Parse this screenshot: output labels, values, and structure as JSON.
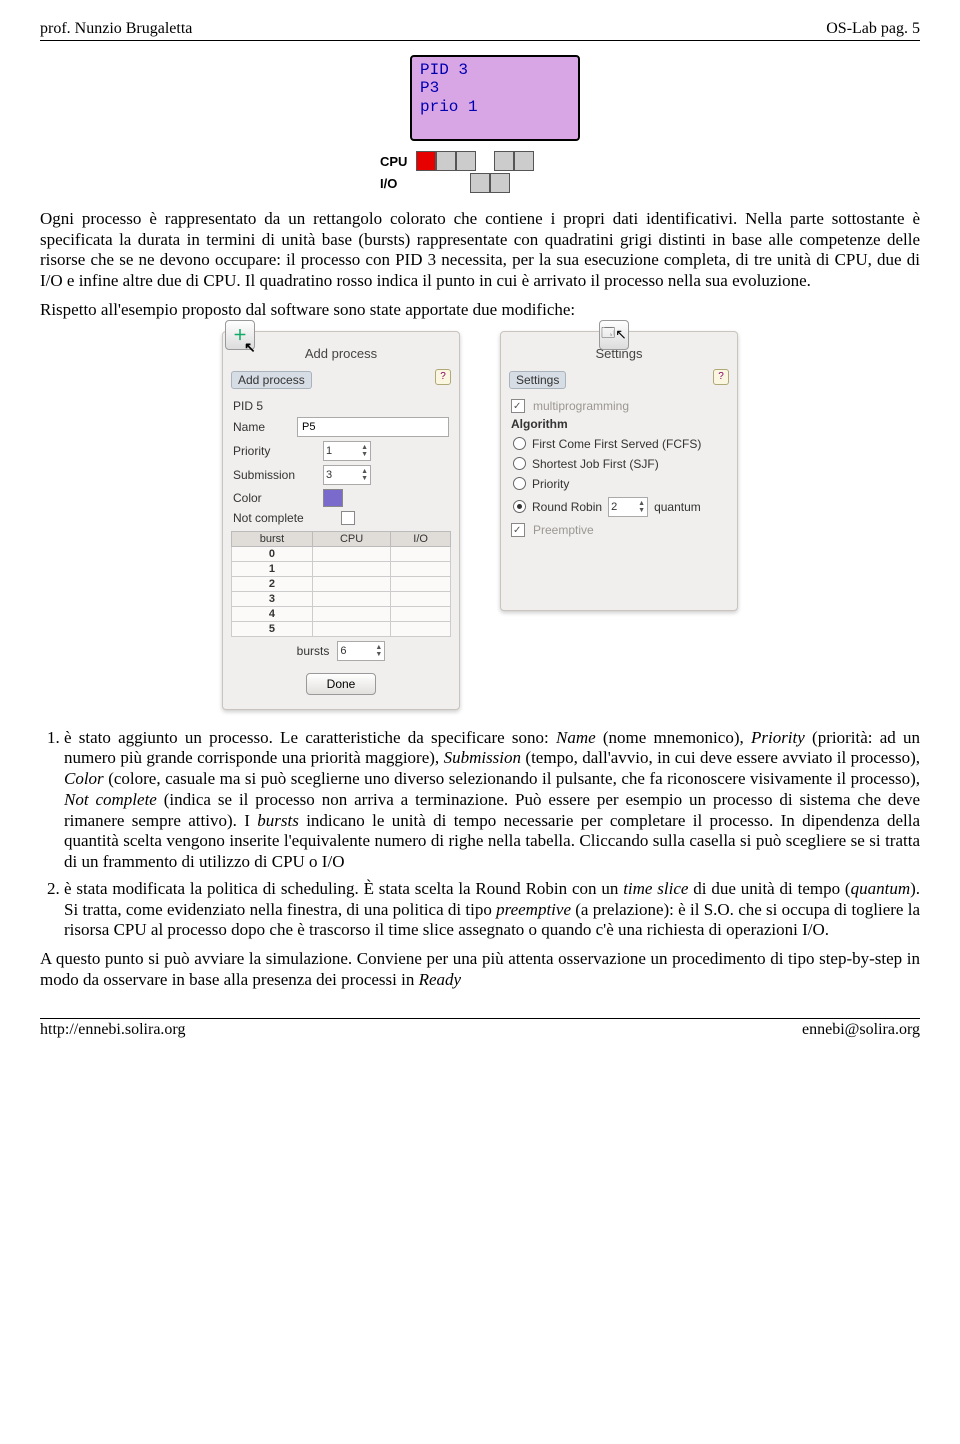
{
  "header": {
    "left": "prof. Nunzio Brugaletta",
    "right": "OS-Lab pag. 5"
  },
  "footer": {
    "left": "http://ennebi.solira.org",
    "right": "ennebi@solira.org"
  },
  "diagram": {
    "pid": "PID 3",
    "pname": "P3",
    "prio": "prio 1",
    "cpu_label": "CPU",
    "io_label": "I/O",
    "cpu_cells": [
      "red",
      "grey",
      "grey",
      "gap",
      "grey",
      "grey"
    ],
    "io_cells": [
      "gap",
      "gap",
      "gap",
      "grey",
      "grey"
    ]
  },
  "para1": "Ogni processo è rappresentato da un rettangolo colorato che contiene i propri dati identificativi. Nella parte sottostante è specificata la durata in termini di unità base (bursts) rappresentate con quadratini grigi distinti in base alle competenze delle risorse che se ne devono occupare: il processo con PID 3 necessita, per la sua esecuzione completa, di tre unità di CPU, due di I/O e infine altre due di CPU. Il quadratino rosso indica il punto in cui è arrivato il processo nella sua evoluzione.",
  "para2": "Rispetto all'esempio proposto dal software sono state apportate due modifiche:",
  "panelA": {
    "title": "Add process",
    "pill": "Add process",
    "help": "?",
    "pid_label": "PID 5",
    "name_label": "Name",
    "name_value": "P5",
    "priority_label": "Priority",
    "priority_value": "1",
    "submission_label": "Submission",
    "submission_value": "3",
    "color_label": "Color",
    "notcomplete_label": "Not complete",
    "tbl_head": [
      "burst",
      "CPU",
      "I/O"
    ],
    "tbl_rows": [
      "0",
      "1",
      "2",
      "3",
      "4",
      "5"
    ],
    "bursts_label": "bursts",
    "bursts_value": "6",
    "done": "Done",
    "icon_glyph": "＋"
  },
  "panelB": {
    "title": "Settings",
    "pill": "Settings",
    "help": "?",
    "multiprog": "multiprogramming",
    "algo_head": "Algorithm",
    "algo": {
      "fcfs": "First Come First Served (FCFS)",
      "sjf": "Shortest Job First (SJF)",
      "prio": "Priority",
      "rr": "Round Robin",
      "rr_val": "2",
      "rr_unit": "quantum"
    },
    "preemptive": "Preemptive",
    "icon_glyph": "🗔"
  },
  "list": {
    "i1a": "è stato aggiunto un processo. Le caratteristiche da specificare sono: ",
    "i1name": "Name",
    "i1b": " (nome mnemonico), ",
    "i1priority": "Priority",
    "i1c": " (priorità: ad un numero più grande corrisponde una priorità maggiore), ",
    "i1submission": "Submission",
    "i1d": " (tempo, dall'avvio, in cui deve essere avviato il processo), ",
    "i1color": "Color",
    "i1e": " (colore, casuale ma si può sceglierne uno diverso selezionando il pulsante, che fa riconoscere visivamente il processo), ",
    "i1nc": "Not complete",
    "i1f": " (indica se il processo non arriva a terminazione. Può essere per esempio un processo di sistema che deve rimanere sempre attivo). I ",
    "i1bursts": "bursts",
    "i1g": " indicano le unità di tempo necessarie per completare il processo. In dipendenza della quantità scelta vengono inserite l'equivalente numero di righe nella tabella. Cliccando sulla casella si può scegliere se si tratta di un frammento di utilizzo di CPU o I/O",
    "i2a": "è stata modificata la politica di scheduling. È stata scelta la Round Robin con un ",
    "i2ts": "time slice",
    "i2b": " di due unità di tempo (",
    "i2q": "quantum",
    "i2c": "). Si tratta, come evidenziato nella finestra, di una politica di tipo ",
    "i2p": "preemptive",
    "i2d": " (a prelazione): è il S.O. che si occupa di togliere la risorsa CPU al processo dopo che è trascorso il time slice assegnato o quando c'è una richiesta di operazioni I/O."
  },
  "para3a": "A questo punto si può avviare la simulazione. Conviene per una più attenta osservazione un procedimento di tipo step-by-step in modo da osservare in base alla presenza dei processi in ",
  "para3b": "Ready"
}
